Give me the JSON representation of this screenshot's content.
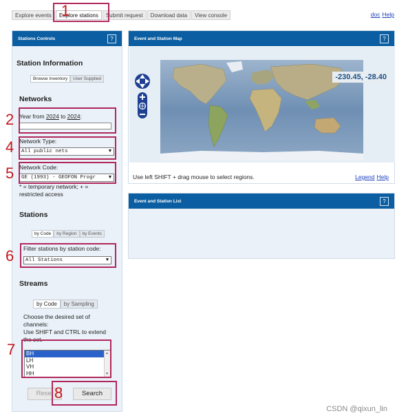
{
  "tabs": [
    {
      "label": "Explore events",
      "active": false
    },
    {
      "label": "Explore stations",
      "active": true
    },
    {
      "label": "Submit request",
      "active": false
    },
    {
      "label": "Download data",
      "active": false
    },
    {
      "label": "View console",
      "active": false
    }
  ],
  "toplinks": {
    "doc": "doc",
    "help": "Help"
  },
  "sidebar": {
    "header": "Stations Controls",
    "help": "?",
    "station_information": {
      "title": "Station Information",
      "toggle": [
        "Browse Inventory",
        "User Supplied"
      ]
    },
    "networks": {
      "title": "Networks",
      "year_prefix": "Year from ",
      "year_from": "2024",
      "year_to_word": " to ",
      "year_to": "2024",
      "year_suffix": ":",
      "network_type_label": "Network Type:",
      "network_type_value": "All public nets",
      "network_code_label": "Network Code:",
      "network_code_value": "GE   (1993) - GEOFON Progr",
      "legend_note": "* = temporary network; + = restricted access"
    },
    "stations": {
      "title": "Stations",
      "toggle": [
        "by Code",
        "by Region",
        "by Events"
      ],
      "filter_label": "Filter stations by station code:",
      "filter_value": "All Stations"
    },
    "streams": {
      "title": "Streams",
      "toggle": [
        "by Code",
        "by Sampling"
      ],
      "instructions": "Choose the desired set of channels:",
      "instructions2": "Use SHIFT and CTRL to extend the set.",
      "channels": [
        "BH",
        "LH",
        "VH",
        "HH"
      ],
      "selected": "BH"
    },
    "buttons": {
      "reset": "Reset",
      "search": "Search"
    }
  },
  "map_panel": {
    "header": "Event and Station Map",
    "help": "?",
    "coords": "-230.45, -28.40",
    "footer": "Use left SHIFT + drag mouse to select regions.",
    "legend_link": "Legend",
    "help_link": "Help"
  },
  "list_panel": {
    "header": "Event and Station List",
    "help": "?"
  },
  "annotations": [
    "1",
    "2",
    "4",
    "5",
    "6",
    "7",
    "8"
  ],
  "watermark": "CSDN @qixun_lin",
  "colors": {
    "panel_header": "#0b5ea1",
    "annotation": "#b0265a",
    "sidebar_bg": "#eaf1f8"
  }
}
